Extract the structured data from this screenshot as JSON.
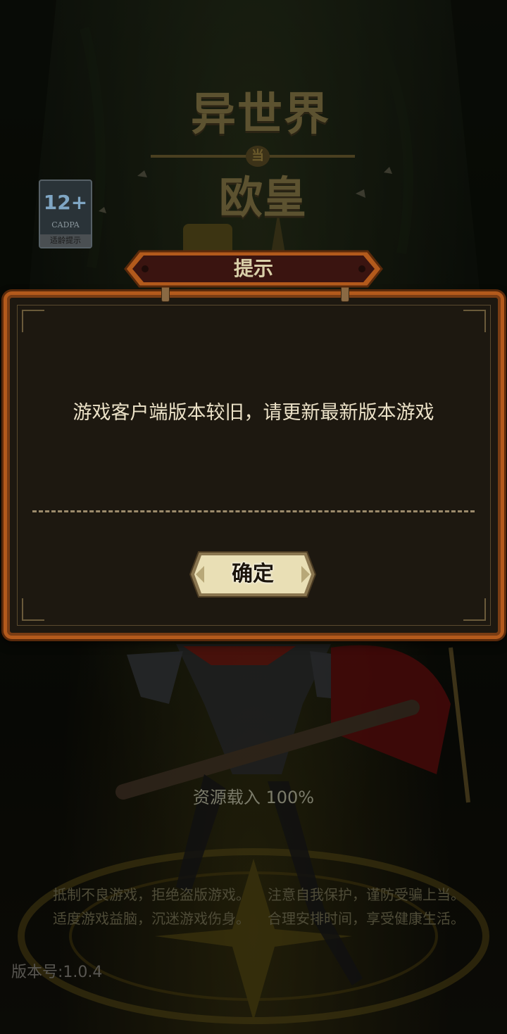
{
  "logo": {
    "line1": "异世界",
    "badge": "当",
    "line2": "欧皇"
  },
  "age_rating": {
    "label": "12+",
    "org": "CADPA",
    "tip": "适龄提示"
  },
  "dialog": {
    "title": "提示",
    "message": "游戏客户端版本较旧，请更新最新版本游戏",
    "confirm_label": "确定"
  },
  "loading": {
    "text": "资源载入 100%"
  },
  "health_notice": {
    "line1_left": "抵制不良游戏，拒绝盗版游戏。",
    "line1_right": "注意自我保护，谨防受骗上当。",
    "line2_left": "适度游戏益脑，沉迷游戏伤身。",
    "line2_right": "合理安排时间，享受健康生活。"
  },
  "version": {
    "text": "版本号:1.0.4"
  },
  "colors": {
    "frame": "#b35a1c",
    "panel": "#1d1810",
    "button": "#e6dcb0",
    "text": "#ece2c8"
  }
}
